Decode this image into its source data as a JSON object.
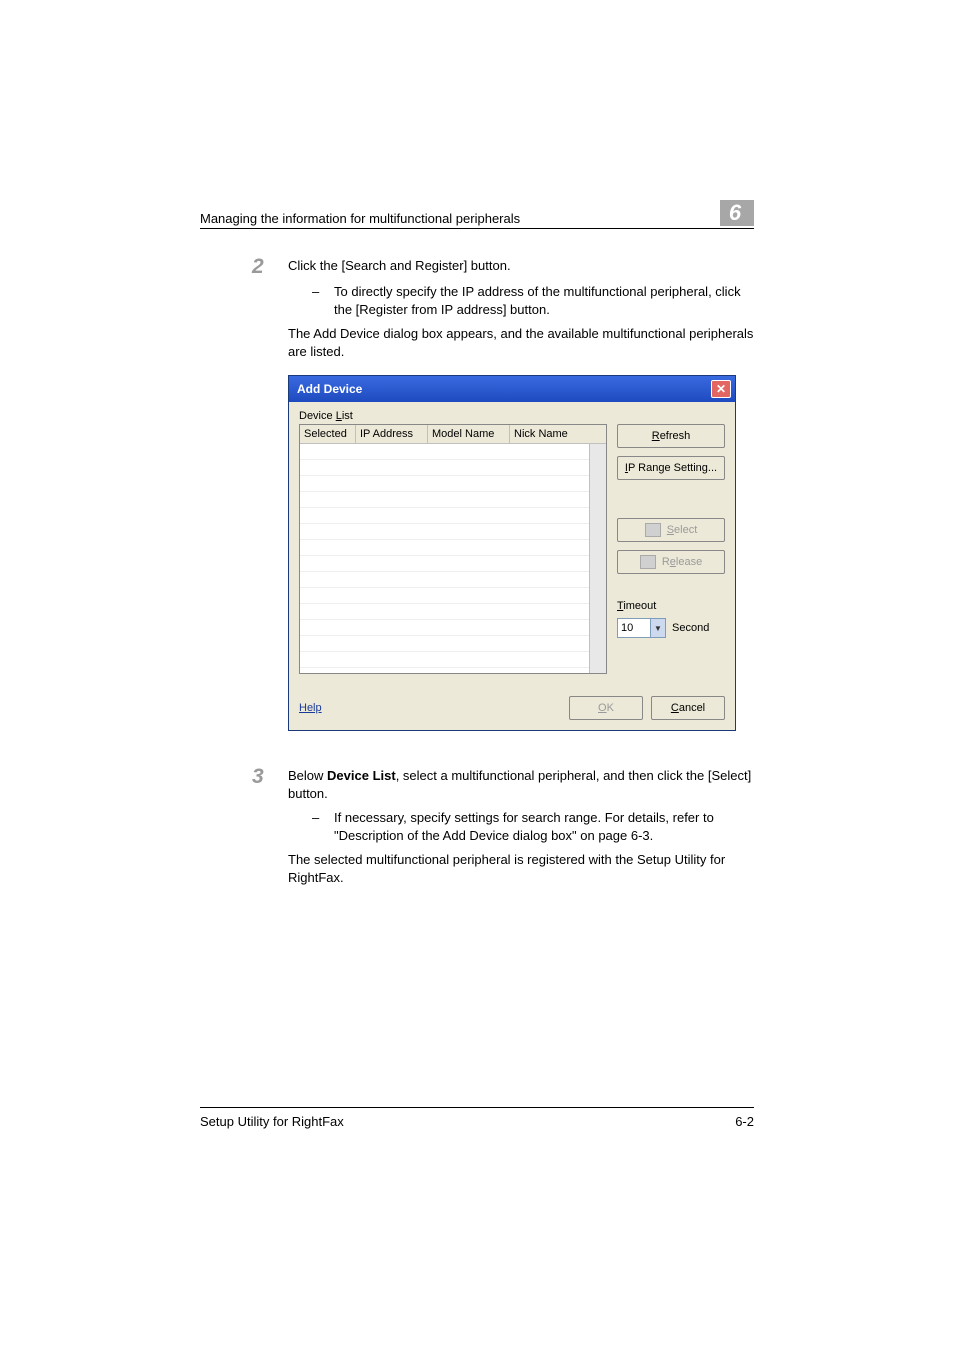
{
  "header": {
    "running_head": "Managing the information for multifunctional peripherals",
    "chapter_number": "6"
  },
  "steps": {
    "s2": {
      "num": "2",
      "text": "Click the [Search and Register] button.",
      "bullet_dash": "–",
      "bullet_text": "To directly specify the IP address of the multifunctional peripheral, click the [Register from IP address] button.",
      "after": "The Add Device dialog box appears, and the available multifunctional peripherals are listed."
    },
    "s3": {
      "num": "3",
      "pre": "Below ",
      "bold": "Device List",
      "post": ", select a multifunctional peripheral, and then click the [Select] button.",
      "bullet_dash": "–",
      "bullet_text": "If necessary, specify settings for search range. For details, refer to \"Description of the Add Device dialog box\" on page 6-3.",
      "after": "The selected multifunctional peripheral is registered with the Setup Utility for RightFax."
    }
  },
  "dialog": {
    "title": "Add Device",
    "device_list_label": "Device List",
    "columns": [
      "Selected",
      "IP Address",
      "Model Name",
      "Nick Name"
    ],
    "buttons": {
      "refresh": "Refresh",
      "ip_range": "IP Range Setting...",
      "select": "Select",
      "release": "Release"
    },
    "timeout_label": "Timeout",
    "timeout_value": "10",
    "timeout_unit": "Second",
    "help": "Help",
    "ok": "OK",
    "cancel": "Cancel"
  },
  "footer": {
    "left": "Setup Utility for RightFax",
    "right": "6-2"
  }
}
